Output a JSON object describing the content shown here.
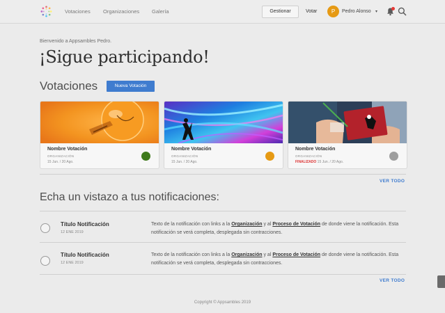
{
  "nav": {
    "links": [
      "Votaciones",
      "Organizaciones",
      "Galería"
    ],
    "gestionar": "Gestionar",
    "votar": "Votar",
    "avatar_letter": "P",
    "user_name": "Pedro Alonso",
    "caret": "▾"
  },
  "welcome": "Bienvenido a Appsambles Pedro.",
  "headline": "¡Sigue participando!",
  "votaciones": {
    "title": "Votaciones",
    "new_button": "Nueva Votación",
    "cards": [
      {
        "title": "Nombre Votación",
        "org": "ORGANIZACIÓN",
        "status": "",
        "dates": "15 Jun. / 20 Ago.",
        "dot_color": "#3f7a1c"
      },
      {
        "title": "Nombre Votación",
        "org": "ORGANIZACIÓN",
        "status": "",
        "dates": "15 Jun. / 20 Ago.",
        "dot_color": "#e69a14"
      },
      {
        "title": "Nombre Votación",
        "org": "ORGANIZACIÓN",
        "status": "FINALIZADO",
        "dates": "15 Jun. / 20 Ago.",
        "dot_color": "#9e9e9e"
      }
    ],
    "ver_todo": "VER TODO"
  },
  "notificaciones": {
    "title": "Echa un vistazo a tus notificaciones:",
    "items": [
      {
        "title": "Título Notificación",
        "date": "12 ENE 2019",
        "text_before": "Texto de la notificación con links a la ",
        "link1": "Organización",
        "text_mid": " y al ",
        "link2": "Proceso de Votación",
        "text_after": " de donde viene la notificación. Esta notificación se verá completa, desplegada sin contracciones."
      },
      {
        "title": "Título Notificación",
        "date": "12 ENE 2019",
        "text_before": "Texto de la notificación con links a la ",
        "link1": "Organización",
        "text_mid": " y al ",
        "link2": "Proceso de Votación",
        "text_after": " de donde viene la notificación. Esta notificación se verá completa, desplegada sin contracciones."
      }
    ],
    "ver_todo": "VER TODO"
  },
  "footer": {
    "copyright": "Copyright © Appsambles 2019"
  },
  "colors": {
    "accent": "#3f7ccf",
    "avatar": "#e69a14",
    "notification_dot": "#e53935",
    "finalizado": "#dd3333"
  }
}
